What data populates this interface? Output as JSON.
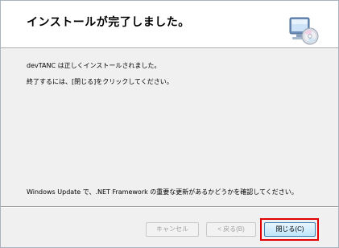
{
  "header": {
    "title": "インストールが完了しました。",
    "icon": "computer-cd-icon"
  },
  "body": {
    "line1": "devTANC は正しくインストールされました。",
    "line2": "終了するには、[閉じる]をクリックしてください。",
    "line3": "Windows Update で、.NET Framework の重要な更新があるかどうかを確認してください。"
  },
  "buttons": {
    "cancel": "キャンセル",
    "back": "< 戻る(B)",
    "close": "閉じる(C)"
  },
  "colors": {
    "highlight": "#e00000",
    "dialog_bg": "#f0f0f0"
  }
}
